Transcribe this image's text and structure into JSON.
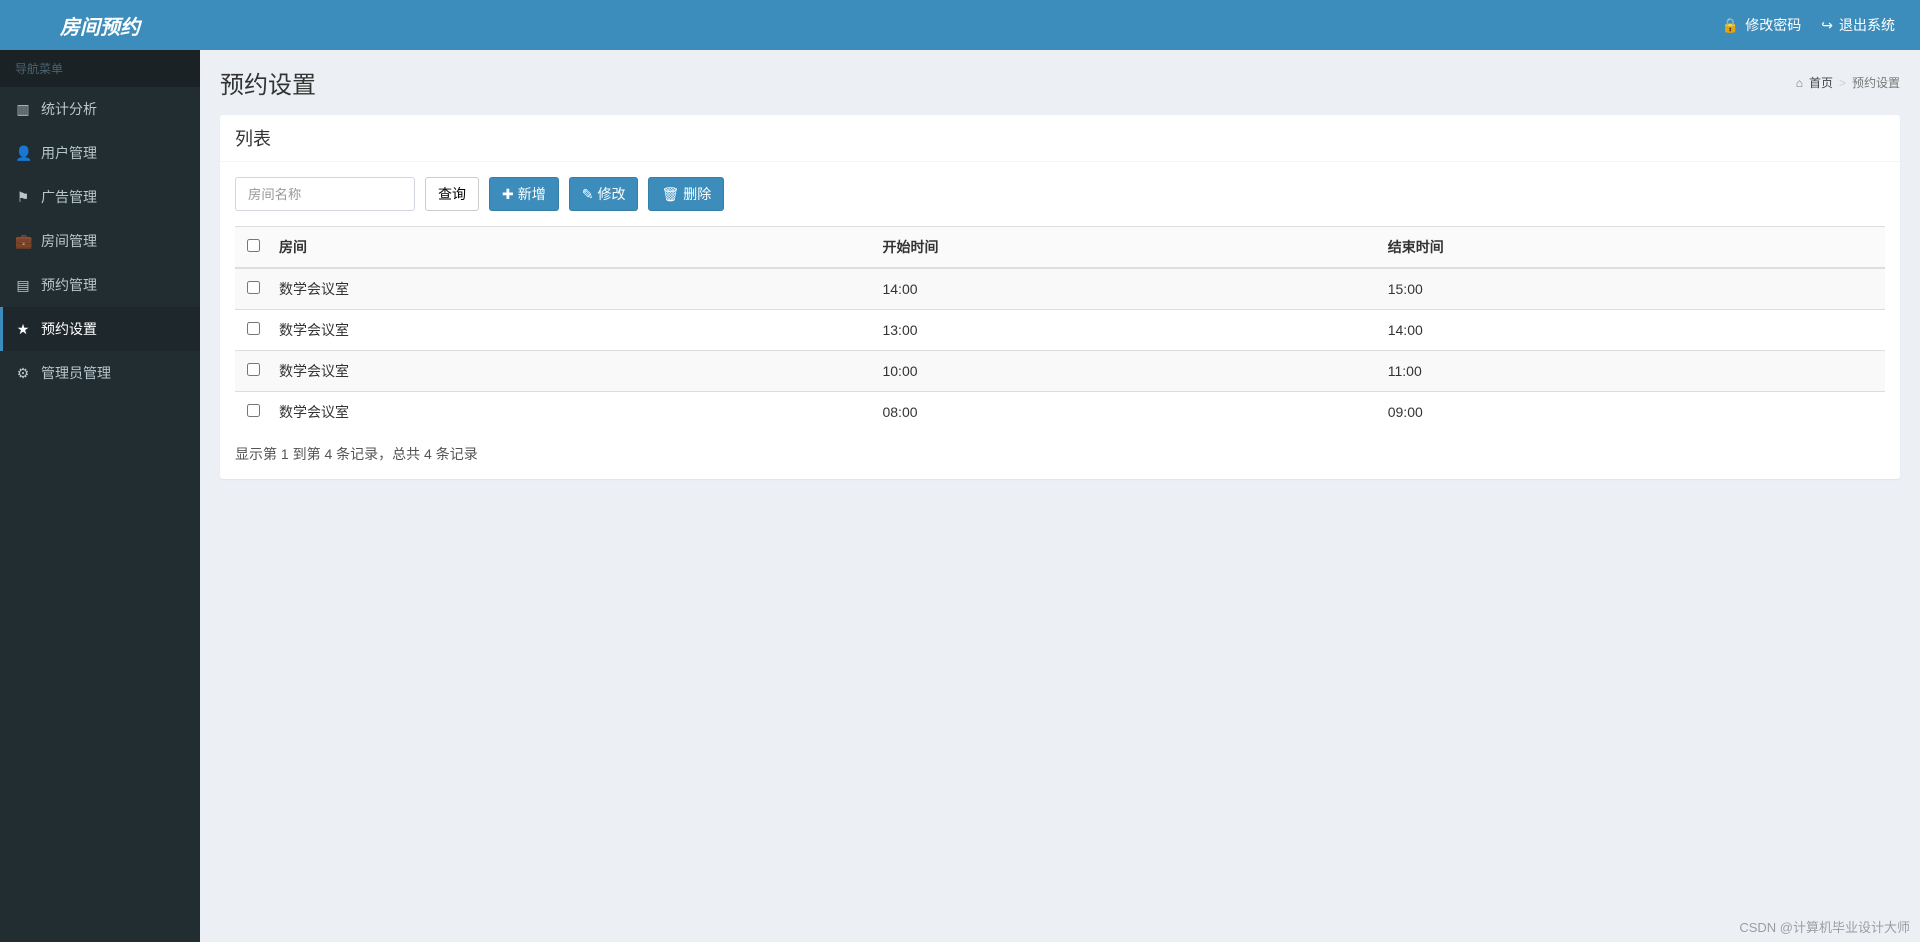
{
  "brand": "房间预约",
  "top_nav": {
    "change_pw": "修改密码",
    "logout": "退出系统"
  },
  "sidebar": {
    "header": "导航菜单",
    "items": [
      {
        "icon": "bar-chart",
        "label": "统计分析"
      },
      {
        "icon": "user",
        "label": "用户管理"
      },
      {
        "icon": "flag",
        "label": "广告管理"
      },
      {
        "icon": "briefcase",
        "label": "房间管理"
      },
      {
        "icon": "file",
        "label": "预约管理"
      },
      {
        "icon": "star",
        "label": "预约设置",
        "active": true
      },
      {
        "icon": "gear",
        "label": "管理员管理"
      }
    ]
  },
  "page": {
    "title": "预约设置",
    "breadcrumb_home": "首页",
    "breadcrumb_current": "预约设置"
  },
  "panel": {
    "title": "列表",
    "search_placeholder": "房间名称",
    "btn_query": "查询",
    "btn_add": "新增",
    "btn_edit": "修改",
    "btn_delete": "删除"
  },
  "table": {
    "columns": [
      "房间",
      "开始时间",
      "结束时间"
    ],
    "rows": [
      {
        "room": "数学会议室",
        "start": "14:00",
        "end": "15:00"
      },
      {
        "room": "数学会议室",
        "start": "13:00",
        "end": "14:00"
      },
      {
        "room": "数学会议室",
        "start": "10:00",
        "end": "11:00"
      },
      {
        "room": "数学会议室",
        "start": "08:00",
        "end": "09:00"
      }
    ]
  },
  "pagination": "显示第 1 到第 4 条记录，总共 4 条记录",
  "watermark": "CSDN @计算机毕业设计大师"
}
